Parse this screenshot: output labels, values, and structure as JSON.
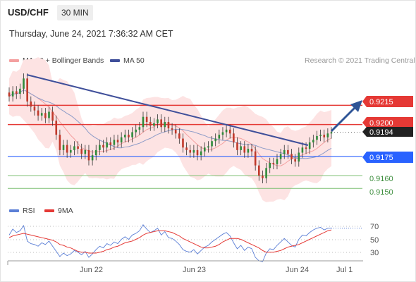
{
  "header": {
    "symbol": "USD/CHF",
    "timeframe": "30 MIN",
    "datetime": "Thursday, June 24, 2021 7:36:32 AM CET",
    "copyright": "Research © 2021 Trading Central"
  },
  "legend": {
    "ma20_label": "MA 20 + Bollinger Bands",
    "ma50_label": "MA 50",
    "rsi_label": "RSI",
    "ma9_label": "9MA"
  },
  "colors": {
    "resistance": "#e53935",
    "support_blue": "#2962ff",
    "support_green": "#7cbf72",
    "trend_line": "#3f4f9a",
    "bollinger_fill": "#fde3e3",
    "ma20": "#f4a0a0",
    "ma50": "#8e9cc8",
    "rsi_line": "#5b7fd6",
    "rsi_ma": "#e53935",
    "candle_up": "#2e8b3a",
    "candle_down": "#c0392b"
  },
  "chart_data": {
    "type": "candlestick",
    "price_range": [
      0.9143,
      0.9245
    ],
    "levels": [
      {
        "name": "resistance-2",
        "value": 0.9215,
        "label": "0.9215",
        "style": "red-box"
      },
      {
        "name": "resistance-1",
        "value": 0.92,
        "label": "0.9200",
        "style": "red-box"
      },
      {
        "name": "last-price",
        "value": 0.9194,
        "label": "0.9194",
        "style": "dark-box"
      },
      {
        "name": "pivot",
        "value": 0.9175,
        "label": "0.9175",
        "style": "blue-box"
      },
      {
        "name": "support-1",
        "value": 0.916,
        "label": "0.9160",
        "style": "green-text"
      },
      {
        "name": "support-2",
        "value": 0.915,
        "label": "0.9150",
        "style": "green-text"
      }
    ],
    "x_axis_labels": [
      "Jun 22",
      "Jun 23",
      "Jun 24",
      "Jul 1"
    ],
    "rsi_range": [
      20,
      80
    ],
    "rsi_levels": [
      "70",
      "50",
      "30"
    ],
    "closes": [
      0.9222,
      0.9226,
      0.9224,
      0.9228,
      0.9236,
      0.9218,
      0.9214,
      0.9211,
      0.9207,
      0.9209,
      0.9205,
      0.921,
      0.9203,
      0.9192,
      0.918,
      0.9184,
      0.9178,
      0.918,
      0.9183,
      0.9181,
      0.9177,
      0.918,
      0.9172,
      0.9176,
      0.918,
      0.9184,
      0.9182,
      0.9186,
      0.9184,
      0.9188,
      0.9186,
      0.919,
      0.9192,
      0.919,
      0.9194,
      0.9196,
      0.9198,
      0.9206,
      0.9202,
      0.9199,
      0.9201,
      0.9204,
      0.9198,
      0.9202,
      0.9197,
      0.9196,
      0.9193,
      0.9189,
      0.9182,
      0.918,
      0.9178,
      0.918,
      0.9176,
      0.9179,
      0.9182,
      0.9183,
      0.9187,
      0.9189,
      0.9192,
      0.9194,
      0.9196,
      0.9193,
      0.9186,
      0.918,
      0.9183,
      0.9178,
      0.9181,
      0.9179,
      0.9168,
      0.916,
      0.9158,
      0.9166,
      0.917,
      0.9169,
      0.9173,
      0.9177,
      0.918,
      0.9177,
      0.9173,
      0.9171,
      0.9178,
      0.9182,
      0.9181,
      0.9186,
      0.9188,
      0.9191,
      0.9192,
      0.919,
      0.9193,
      0.9194
    ],
    "rsi": [
      55,
      62,
      58,
      60,
      66,
      48,
      45,
      44,
      42,
      46,
      44,
      48,
      42,
      36,
      30,
      34,
      31,
      33,
      37,
      35,
      32,
      36,
      29,
      33,
      38,
      42,
      40,
      45,
      43,
      47,
      45,
      50,
      53,
      50,
      55,
      57,
      60,
      67,
      62,
      58,
      60,
      63,
      55,
      59,
      52,
      51,
      48,
      44,
      38,
      36,
      35,
      38,
      33,
      37,
      41,
      43,
      47,
      50,
      53,
      56,
      58,
      54,
      46,
      39,
      43,
      37,
      41,
      39,
      29,
      25,
      24,
      34,
      39,
      38,
      43,
      47,
      51,
      47,
      43,
      41,
      50,
      55,
      54,
      58,
      61,
      63,
      64,
      61,
      63,
      63
    ],
    "rsi_ma9": [
      52,
      54,
      55,
      56,
      57,
      56,
      55,
      54,
      53,
      52,
      51,
      50,
      49,
      47,
      44,
      43,
      41,
      40,
      38,
      36,
      35,
      35,
      34,
      34,
      34,
      35,
      36,
      38,
      39,
      41,
      42,
      44,
      46,
      47,
      48,
      50,
      52,
      55,
      57,
      58,
      59,
      60,
      60,
      60,
      59,
      58,
      56,
      54,
      51,
      49,
      47,
      45,
      43,
      41,
      40,
      40,
      41,
      42,
      44,
      47,
      49,
      51,
      51,
      51,
      50,
      48,
      46,
      44,
      42,
      40,
      37,
      35,
      35,
      35,
      36,
      37,
      39,
      41,
      42,
      43,
      44,
      46,
      48,
      50,
      52,
      54,
      56,
      58,
      60,
      61
    ]
  },
  "axis": {
    "x0": "Jun 22",
    "x1": "Jun 23",
    "x2": "Jun 24",
    "x3": "Jul 1",
    "r70": "70",
    "r50": "50",
    "r30": "30"
  },
  "labels": {
    "l9215": "0.9215",
    "l9200": "0.9200",
    "l9194": "0.9194",
    "l9175": "0.9175",
    "l9160": "0.9160",
    "l9150": "0.9150"
  }
}
